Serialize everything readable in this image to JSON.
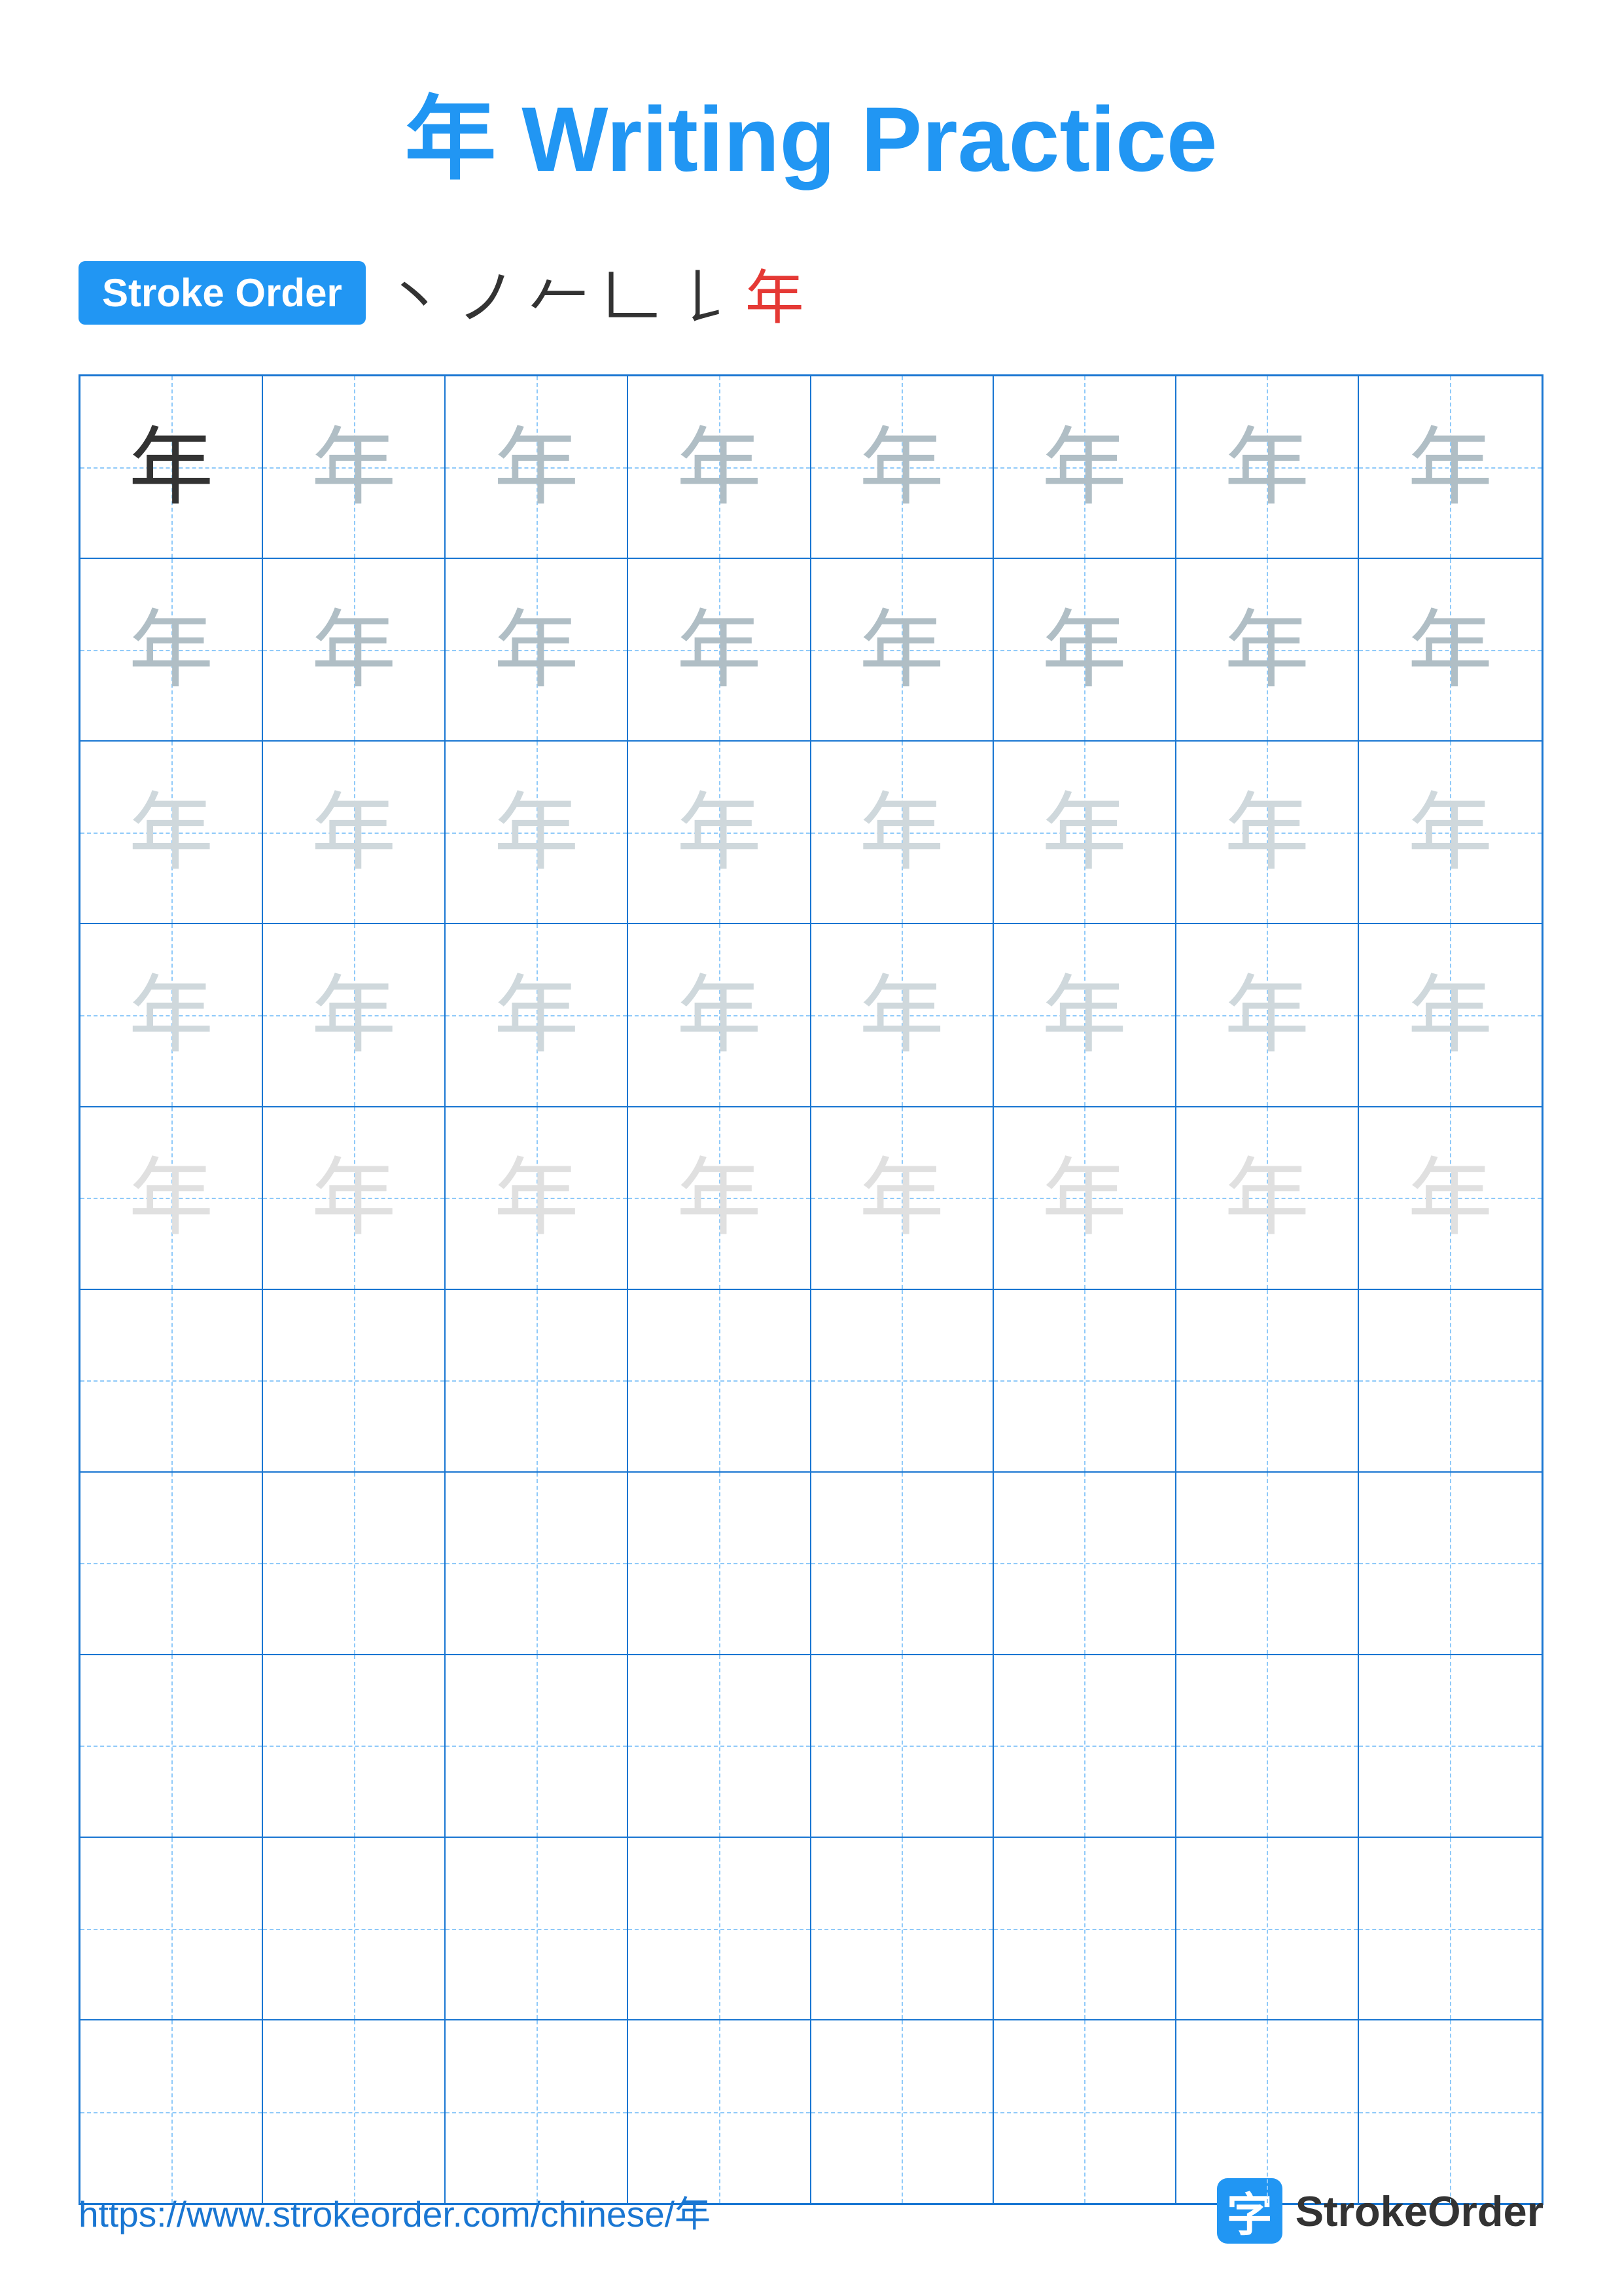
{
  "title": {
    "char": "年",
    "label": "Writing Practice",
    "full": "年 Writing Practice"
  },
  "stroke_order": {
    "badge_label": "Stroke Order",
    "sequence": [
      "丶",
      "ノ",
      "𠂉",
      "𠃊",
      "𠄌",
      "年"
    ]
  },
  "grid": {
    "rows": 10,
    "cols": 8,
    "char": "年",
    "guide_rows": 5,
    "empty_rows": 5
  },
  "footer": {
    "url": "https://www.strokeorder.com/chinese/年",
    "brand": "StrokeOrder",
    "logo_char": "字"
  }
}
